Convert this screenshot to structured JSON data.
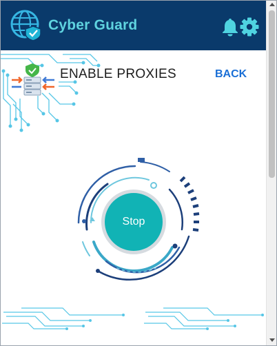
{
  "header": {
    "app_title": "Cyber Guard",
    "logo_icon": "globe-shield-icon",
    "notifications_icon": "bell-icon",
    "settings_icon": "gear-icon"
  },
  "page": {
    "title": "ENABLE PROXIES",
    "back_label": "BACK",
    "illustration_icon": "proxy-server-shield-icon"
  },
  "control": {
    "stop_label": "Stop"
  },
  "colors": {
    "header_bg": "#0a3a6b",
    "title_accent": "#5fd3df",
    "back_link": "#1a6fd6",
    "stop_button": "#11b3b5",
    "circuit": "#4fc8e0"
  }
}
